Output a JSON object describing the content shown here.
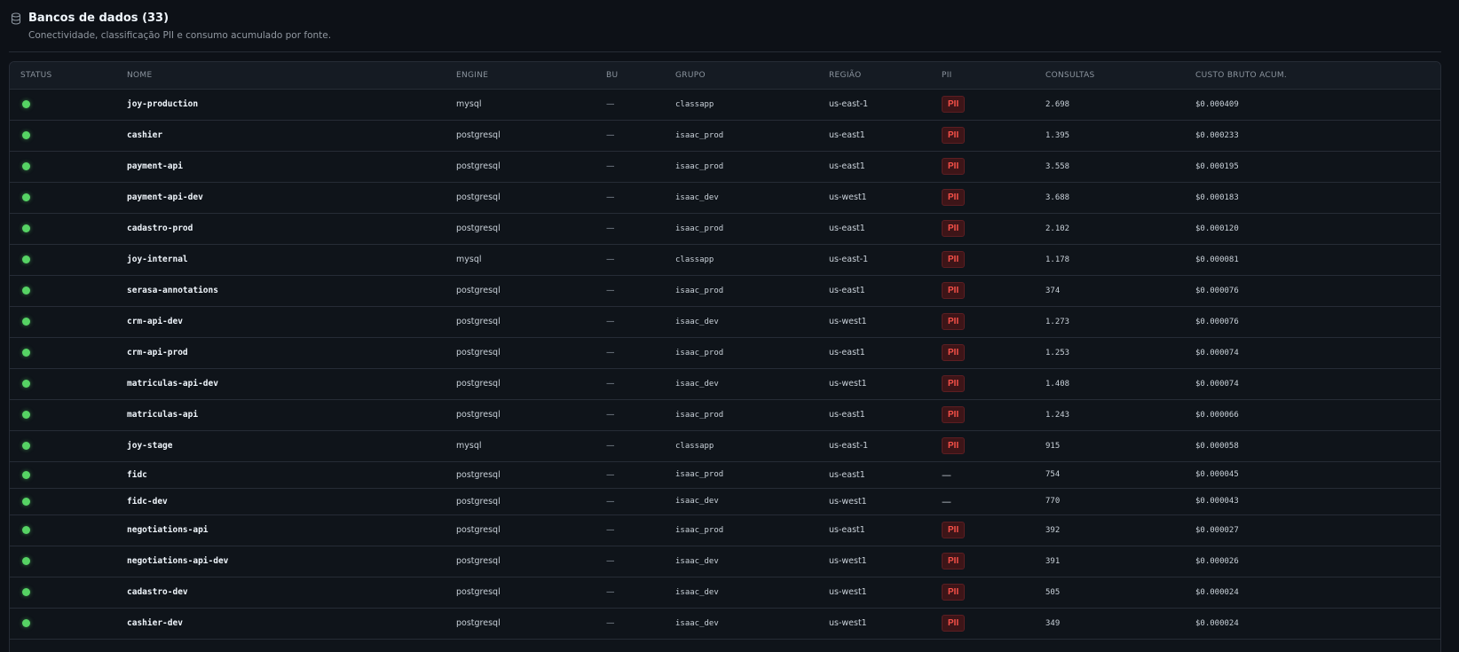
{
  "section": {
    "title": "Bancos de dados (33)",
    "subtitle": "Conectividade, classificação PII e consumo acumulado por fonte.",
    "icon": "database-icon"
  },
  "colors": {
    "background": "#0d1117",
    "status_ok": "#56d364",
    "pii_badge_text": "#f85149",
    "pii_badge_bg": "#3d1518"
  },
  "table": {
    "columns": {
      "status": "STATUS",
      "name": "NOME",
      "engine": "ENGINE",
      "bu": "BU",
      "group": "GRUPO",
      "region": "REGIÃO",
      "pii": "PII",
      "queries": "CONSULTAS",
      "cost": "CUSTO BRUTO ACUM."
    },
    "rows": [
      {
        "status": "ok",
        "name": "joy-production",
        "engine": "mysql",
        "bu": "—",
        "group": "classapp",
        "region": "us-east-1",
        "pii": "PII",
        "queries": "2.698",
        "cost": "$0.000409"
      },
      {
        "status": "ok",
        "name": "cashier",
        "engine": "postgresql",
        "bu": "—",
        "group": "isaac_prod",
        "region": "us-east1",
        "pii": "PII",
        "queries": "1.395",
        "cost": "$0.000233"
      },
      {
        "status": "ok",
        "name": "payment-api",
        "engine": "postgresql",
        "bu": "—",
        "group": "isaac_prod",
        "region": "us-east1",
        "pii": "PII",
        "queries": "3.558",
        "cost": "$0.000195"
      },
      {
        "status": "ok",
        "name": "payment-api-dev",
        "engine": "postgresql",
        "bu": "—",
        "group": "isaac_dev",
        "region": "us-west1",
        "pii": "PII",
        "queries": "3.688",
        "cost": "$0.000183"
      },
      {
        "status": "ok",
        "name": "cadastro-prod",
        "engine": "postgresql",
        "bu": "—",
        "group": "isaac_prod",
        "region": "us-east1",
        "pii": "PII",
        "queries": "2.102",
        "cost": "$0.000120"
      },
      {
        "status": "ok",
        "name": "joy-internal",
        "engine": "mysql",
        "bu": "—",
        "group": "classapp",
        "region": "us-east-1",
        "pii": "PII",
        "queries": "1.178",
        "cost": "$0.000081"
      },
      {
        "status": "ok",
        "name": "serasa-annotations",
        "engine": "postgresql",
        "bu": "—",
        "group": "isaac_prod",
        "region": "us-east1",
        "pii": "PII",
        "queries": "374",
        "cost": "$0.000076"
      },
      {
        "status": "ok",
        "name": "crm-api-dev",
        "engine": "postgresql",
        "bu": "—",
        "group": "isaac_dev",
        "region": "us-west1",
        "pii": "PII",
        "queries": "1.273",
        "cost": "$0.000076"
      },
      {
        "status": "ok",
        "name": "crm-api-prod",
        "engine": "postgresql",
        "bu": "—",
        "group": "isaac_prod",
        "region": "us-east1",
        "pii": "PII",
        "queries": "1.253",
        "cost": "$0.000074"
      },
      {
        "status": "ok",
        "name": "matriculas-api-dev",
        "engine": "postgresql",
        "bu": "—",
        "group": "isaac_dev",
        "region": "us-west1",
        "pii": "PII",
        "queries": "1.408",
        "cost": "$0.000074"
      },
      {
        "status": "ok",
        "name": "matriculas-api",
        "engine": "postgresql",
        "bu": "—",
        "group": "isaac_prod",
        "region": "us-east1",
        "pii": "PII",
        "queries": "1.243",
        "cost": "$0.000066"
      },
      {
        "status": "ok",
        "name": "joy-stage",
        "engine": "mysql",
        "bu": "—",
        "group": "classapp",
        "region": "us-east-1",
        "pii": "PII",
        "queries": "915",
        "cost": "$0.000058"
      },
      {
        "status": "ok",
        "name": "fidc",
        "engine": "postgresql",
        "bu": "—",
        "group": "isaac_prod",
        "region": "us-east1",
        "pii": "—",
        "queries": "754",
        "cost": "$0.000045"
      },
      {
        "status": "ok",
        "name": "fidc-dev",
        "engine": "postgresql",
        "bu": "—",
        "group": "isaac_dev",
        "region": "us-west1",
        "pii": "—",
        "queries": "770",
        "cost": "$0.000043"
      },
      {
        "status": "ok",
        "name": "negotiations-api",
        "engine": "postgresql",
        "bu": "—",
        "group": "isaac_prod",
        "region": "us-east1",
        "pii": "PII",
        "queries": "392",
        "cost": "$0.000027"
      },
      {
        "status": "ok",
        "name": "negotiations-api-dev",
        "engine": "postgresql",
        "bu": "—",
        "group": "isaac_dev",
        "region": "us-west1",
        "pii": "PII",
        "queries": "391",
        "cost": "$0.000026"
      },
      {
        "status": "ok",
        "name": "cadastro-dev",
        "engine": "postgresql",
        "bu": "—",
        "group": "isaac_dev",
        "region": "us-west1",
        "pii": "PII",
        "queries": "505",
        "cost": "$0.000024"
      },
      {
        "status": "ok",
        "name": "cashier-dev",
        "engine": "postgresql",
        "bu": "—",
        "group": "isaac_dev",
        "region": "us-west1",
        "pii": "PII",
        "queries": "349",
        "cost": "$0.000024"
      }
    ]
  }
}
